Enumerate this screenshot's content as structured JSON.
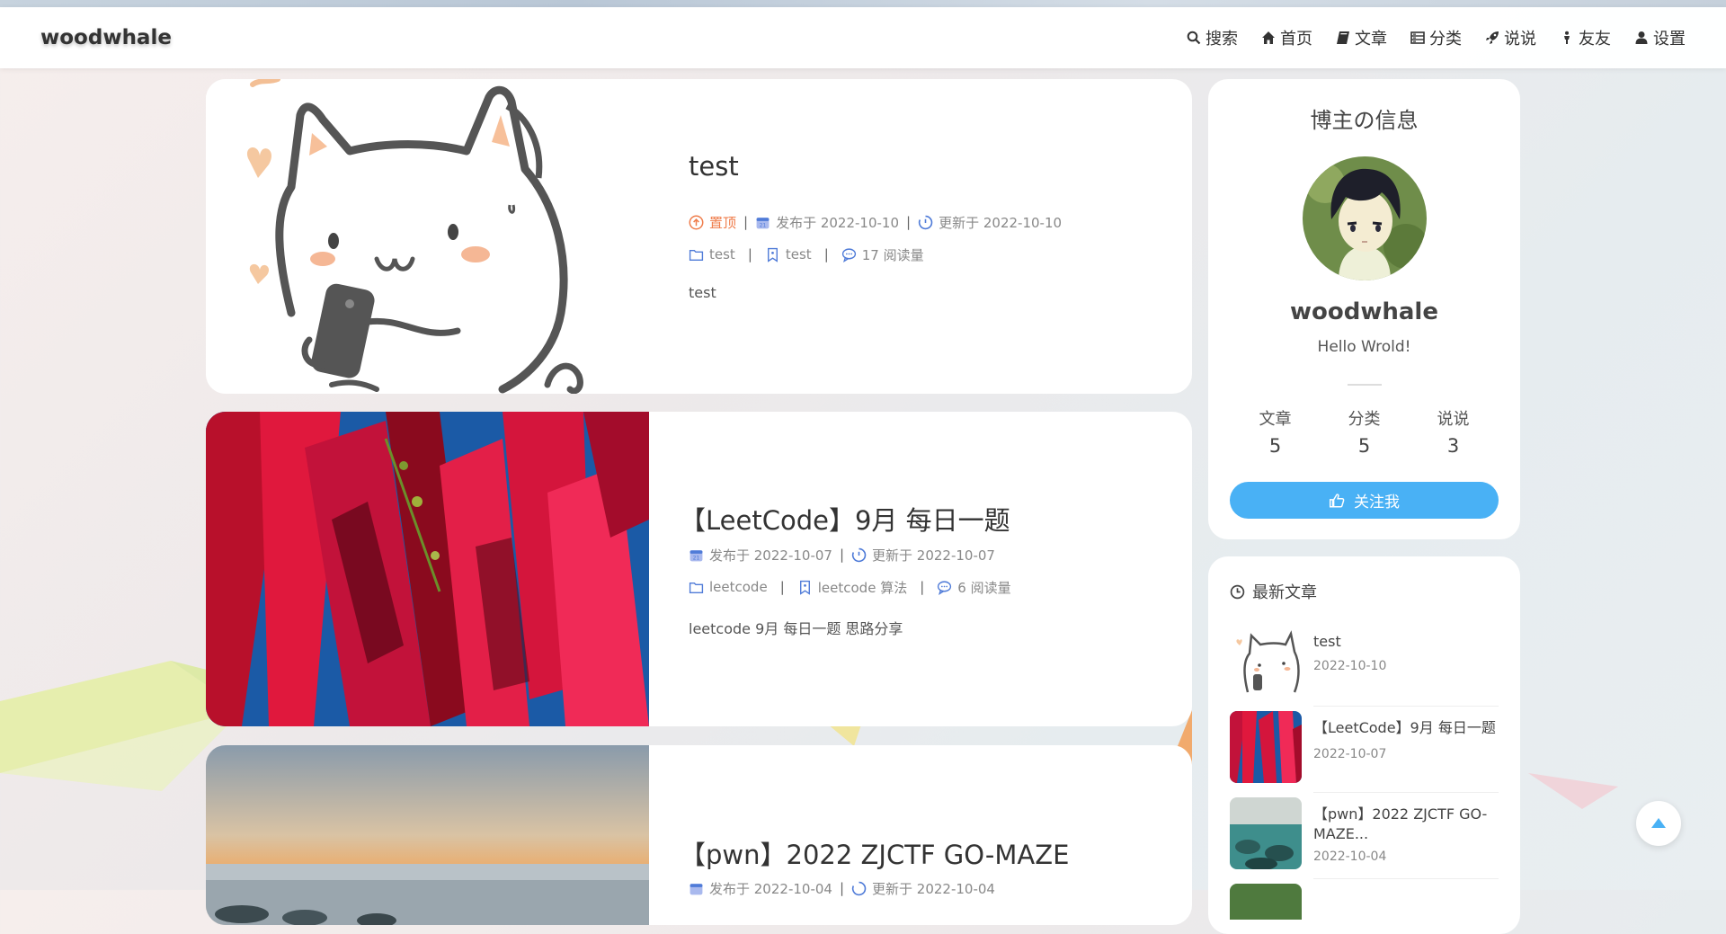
{
  "site": {
    "brand": "woodwhale"
  },
  "nav": [
    {
      "label": "搜索",
      "icon": "search-icon"
    },
    {
      "label": "首页",
      "icon": "home-icon"
    },
    {
      "label": "文章",
      "icon": "book-icon"
    },
    {
      "label": "分类",
      "icon": "archive-icon"
    },
    {
      "label": "说说",
      "icon": "rocket-icon"
    },
    {
      "label": "友友",
      "icon": "user-link-icon"
    },
    {
      "label": "设置",
      "icon": "user-icon"
    }
  ],
  "posts": [
    {
      "title": "test",
      "pinned": "置顶",
      "published": "发布于 2022-10-10",
      "updated": "更新于 2022-10-10",
      "category": "test",
      "tags": "test",
      "views": "17 阅读量",
      "excerpt": "test"
    },
    {
      "title": "【LeetCode】9月 每日一题",
      "published": "发布于 2022-10-07",
      "updated": "更新于 2022-10-07",
      "category": "leetcode",
      "tags": "leetcode 算法",
      "views": "6 阅读量",
      "excerpt": "leetcode 9月 每日一题 思路分享"
    },
    {
      "title": "【pwn】2022 ZJCTF GO-MAZE",
      "published": "发布于 2022-10-04",
      "updated": "更新于 2022-10-04"
    }
  ],
  "profile": {
    "title": "博主の信息",
    "name": "woodwhale",
    "motto": "Hello Wrold!",
    "stats": [
      {
        "label": "文章",
        "value": "5"
      },
      {
        "label": "分类",
        "value": "5"
      },
      {
        "label": "说说",
        "value": "3"
      }
    ],
    "follow_label": "关注我"
  },
  "recent": {
    "heading": "最新文章",
    "items": [
      {
        "title": "test",
        "date": "2022-10-10"
      },
      {
        "title": "【LeetCode】9月 每日一题",
        "date": "2022-10-07"
      },
      {
        "title": "【pwn】2022 ZJCTF GO-MAZE...",
        "date": "2022-10-04"
      }
    ]
  },
  "colors": {
    "accent": "#49b1f5",
    "pin": "#ef7c4a",
    "meta_icon": "#4f7bd8"
  }
}
